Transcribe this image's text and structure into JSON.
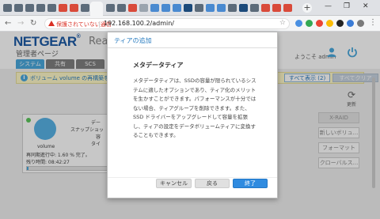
{
  "browser": {
    "security_warning": "保護されていない通信",
    "url": "192.168.100.2/admin/",
    "new_tab": "+",
    "window_controls": [
      "—",
      "❐",
      "✕"
    ]
  },
  "header": {
    "logo": "NETGEAR",
    "logo_mark": "®",
    "product_partial": "Rea",
    "admin_page": "管理者ページ",
    "welcome": "ようこそ admin"
  },
  "nav": {
    "tabs": [
      {
        "label": "システム",
        "active": true
      },
      {
        "label": "共有",
        "active": false
      },
      {
        "label": "SCS",
        "active": false
      }
    ]
  },
  "notice": {
    "text": "ボリューム volume の再構築を",
    "show_all": "すべて表示 (2)",
    "clear_all": "すべてクリア"
  },
  "refresh": {
    "label": "更新"
  },
  "volume": {
    "name": "volume",
    "sync_status": "再同期進行中: 1.60 % 完了。",
    "remaining": "残り時間: 08:42:27",
    "progress": 0.016,
    "side_labels": [
      "デー",
      "スナップショッ",
      "容",
      "タイ"
    ]
  },
  "side_buttons": [
    "X-RAID",
    "新しいボリュ...",
    "フォーマット",
    "クローバルス..."
  ],
  "modal": {
    "title": "ティアの追加",
    "heading": "メタデータティア",
    "body": "メタデータティアは、SSDの容量が限られているシステムに適したオプションであり、ティア化のメリットを生かすことができます。パフォーマンスが十分ではない場合、ティアグループを削除できます。また、SSD ドライバーをアップグレードして容量を拡張し、ティアの設定をデータボリュームティアに変換することもできます。",
    "cancel": "キャンセル",
    "back": "戻る",
    "finish": "終了"
  },
  "colors": {
    "brand": "#1c5aa6",
    "accent": "#4aa8dd",
    "primary_button": "#2f8be0",
    "warning": "#d93025"
  }
}
